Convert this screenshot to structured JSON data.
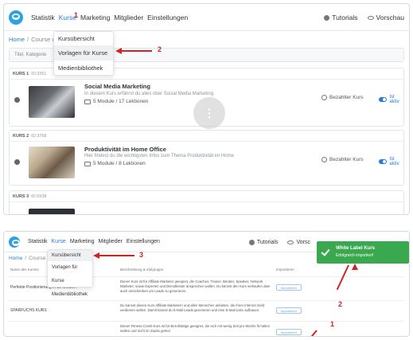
{
  "shot1": {
    "nav": {
      "items": [
        "Statistik",
        "Kurse",
        "Marketing",
        "Mitglieder",
        "Einstellungen"
      ],
      "tutorials": "Tutorials",
      "preview": "Vorschau"
    },
    "breadcrumb": {
      "home": "Home",
      "current": "Course ov"
    },
    "filter_placeholder": "Titel, Kategorie",
    "dropdown": [
      "Kursübersicht",
      "Vorlagen für Kurse",
      "Medienbibliothek"
    ],
    "annotations": {
      "n1": "1",
      "n2": "2"
    },
    "courses": [
      {
        "label": "KURS 1",
        "id": "ID:3351",
        "title": "Social Media Marketing",
        "desc": "In diesem Kurs erfährst du alles über Social Media Marketing",
        "meta": "5 Module / 17 Lektionen",
        "paid": "Bezahlter Kurs",
        "status": "Ist aktiv"
      },
      {
        "label": "KURS 2",
        "id": "ID:3768",
        "title": "Produktivität im Home Office",
        "desc": "Hier findest du die wichtigsten Infos zum Thema Produktivität im Home",
        "meta": "5 Module / 8 Lektionen",
        "paid": "Bezahlter Kurs",
        "status": "Ist aktiv"
      },
      {
        "label": "KURS 3",
        "id": "ID:5938"
      }
    ]
  },
  "shot2": {
    "nav": {
      "items": [
        "Statistik",
        "Kurse",
        "Marketing",
        "Mitglieder",
        "Einstellungen"
      ],
      "tutorials": "Tutorials",
      "preview": "Vorsc"
    },
    "breadcrumb": {
      "home": "Home",
      "current": "Course ov"
    },
    "dropdown": [
      "Kursübersicht",
      "Vorlagen für Kurse",
      "Medienbibliothek"
    ],
    "annotations": {
      "n1": "1",
      "n2": "2",
      "n3": "3"
    },
    "toast": {
      "title": "White Label Kurs",
      "message": "Erfolgreich importiert!"
    },
    "table": {
      "headers": [
        "Name des Kurses",
        "Beschreibung & Zielgruppe",
        "Importieren"
      ],
      "rows": [
        {
          "name": "Perfekte Positionierung in 30 Minuten",
          "desc": "Dieser Kurs ist für Affiliate Marketer geeignet, die Coaches, Trainer, Berater, Speaker, Network Marketer, sowie Experten und Dienstleister ansprechen wollen. Du kannst den Kurs verkaufen aber auch verschenken um Leads zu generieren.",
          "button": "Importieren"
        },
        {
          "name": "SPARFUCHS KURS",
          "desc": "Du kannst diesen Kurs Affiliate Marketern und allen Menschen anbieten, die ihren Internet Geld verdienen wollen. Damit kannst du E-Mail Leads generieren und eine E-Mail Liste aufbauen.",
          "button": "Importieren"
        },
        {
          "name": "",
          "desc": "Dieser Fitness-Crash-Kurs ist für Berufstätige geeignet, die sich mit wenig Zeit pro Woche fit halten wollen und nicht im Studio gehen",
          "button": "Importieren"
        }
      ]
    }
  },
  "colors": {
    "accent": "#2a7bd6",
    "annotation": "#d32222",
    "success": "#3aa84f",
    "logo": "#2aa3e0"
  }
}
